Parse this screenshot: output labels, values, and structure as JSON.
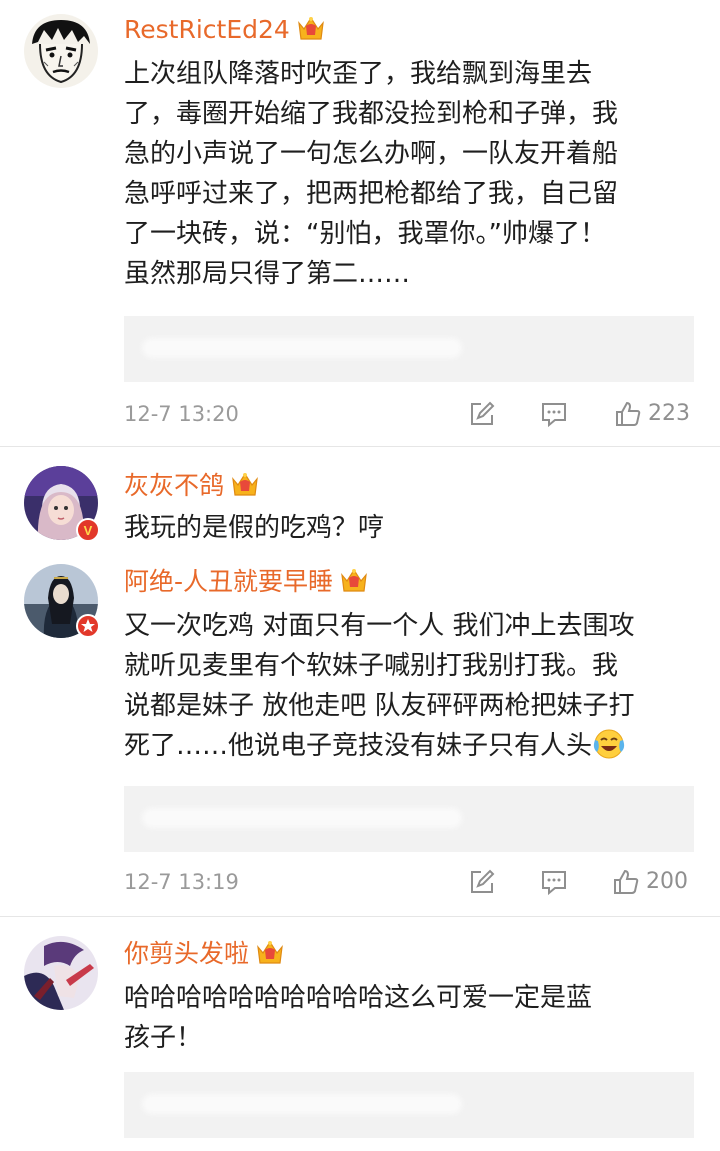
{
  "comments": [
    {
      "username": "RestRictEd24",
      "lines": [
        "上次组队降落时吹歪了，我给飘到海里去",
        "了，毒圈开始缩了我都没捡到枪和子弹，我",
        "急的小声说了一句怎么办啊，一队友开着船",
        "急呼呼过来了，把两把枪都给了我，自己留",
        "了一块砖，说：“别怕，我罩你。”帅爆了！",
        "虽然那局只得了第二……"
      ],
      "time": "12-7 13:20",
      "likes": "223"
    },
    {
      "username": "灰灰不鸽",
      "lines": [
        "我玩的是假的吃鸡？哼"
      ],
      "verified": "V"
    },
    {
      "username": "阿绝-人丑就要早睡",
      "lines": [
        "又一次吃鸡 对面只有一个人 我们冲上去围攻",
        "就听见麦里有个软妹子喊别打我别打我。我",
        "说都是妹子 放他走吧 队友砰砰两枪把妹子打",
        "死了……他说电子竞技没有妹子只有人头"
      ],
      "time": "12-7 13:19",
      "likes": "200"
    },
    {
      "username": "你剪头发啦",
      "lines": [
        "哈哈哈哈哈哈哈哈哈哈这么可爱一定是蓝",
        "孩子！"
      ]
    }
  ],
  "icons": {
    "crown": "vip-crown-icon",
    "repost": "repost-icon",
    "reply": "comment-icon",
    "like": "thumbs-up-icon",
    "laugh": "laughing-crying-emoji"
  },
  "colors": {
    "username": "#e8692a",
    "meta": "#9a9a9a",
    "reply_bg": "#f2f2f2",
    "verified_badge": "#e2382a"
  }
}
